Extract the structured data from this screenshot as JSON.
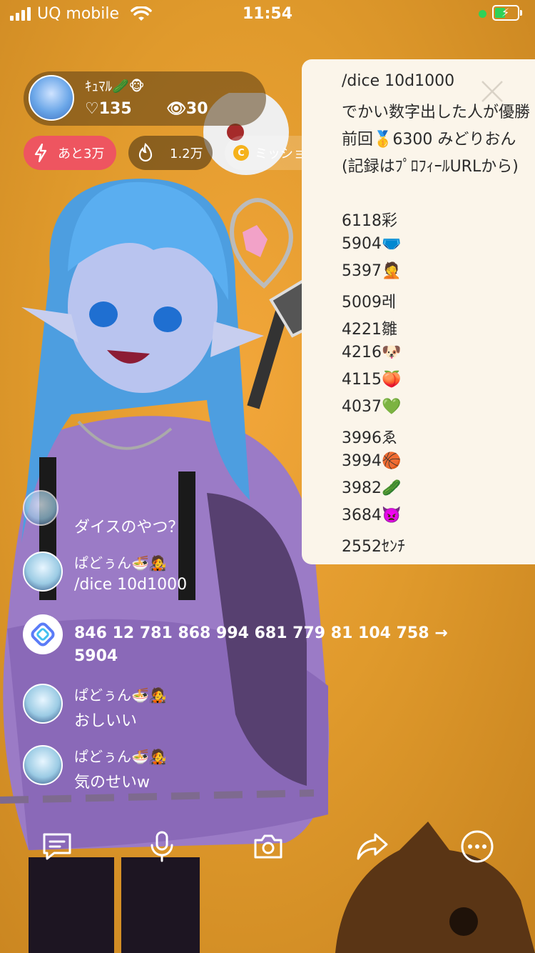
{
  "status_bar": {
    "carrier": "UQ mobile",
    "time": "11:54"
  },
  "streamer": {
    "name": "ｷｭﾏﾙ🥒🐵",
    "likes": "♡135",
    "viewers": "👁30"
  },
  "pills": {
    "rank_label": "あと3万",
    "points_label": "1.2万",
    "mission_label": "ミッション"
  },
  "notice": {
    "lines": [
      "/dice 10d1000",
      "でかい数字出した人が優勝",
      "前回🥇6300 みどりおん",
      "(記録はﾌﾟﾛﾌｨｰﾙURLから)",
      "",
      "6118彩",
      "5904🩲",
      "5397🤦",
      "5009레",
      "4221雛",
      "4216🐶",
      "4115🍑",
      "4037💚",
      "3996ゑ",
      "3994🏀",
      "3982🥒",
      "3684👿",
      "2552ｾﾝﾁ"
    ]
  },
  "comments": [
    {
      "name": "",
      "text": "ダイスのやつ？"
    },
    {
      "name": "ぱどぅん🍜🧑‍🎤",
      "text": "/dice 10d1000"
    },
    {
      "name": "",
      "text": "846 12 781 868 994 681 779 81 104 758 →",
      "text2": "5904"
    },
    {
      "name": "ぱどぅん🍜🧑‍🎤",
      "text": "おしいい"
    },
    {
      "name": "ぱどぅん🍜🧑‍🎤",
      "text": "気のせいw"
    }
  ],
  "toolbar": {
    "icons": [
      "comment-icon",
      "microphone-icon",
      "camera-icon",
      "share-icon",
      "more-icon"
    ]
  },
  "colors": {
    "background": "#e09a2c",
    "panel": "#fbf5ea",
    "pill_red": "#ee5560",
    "accent_green": "#2fd158"
  }
}
